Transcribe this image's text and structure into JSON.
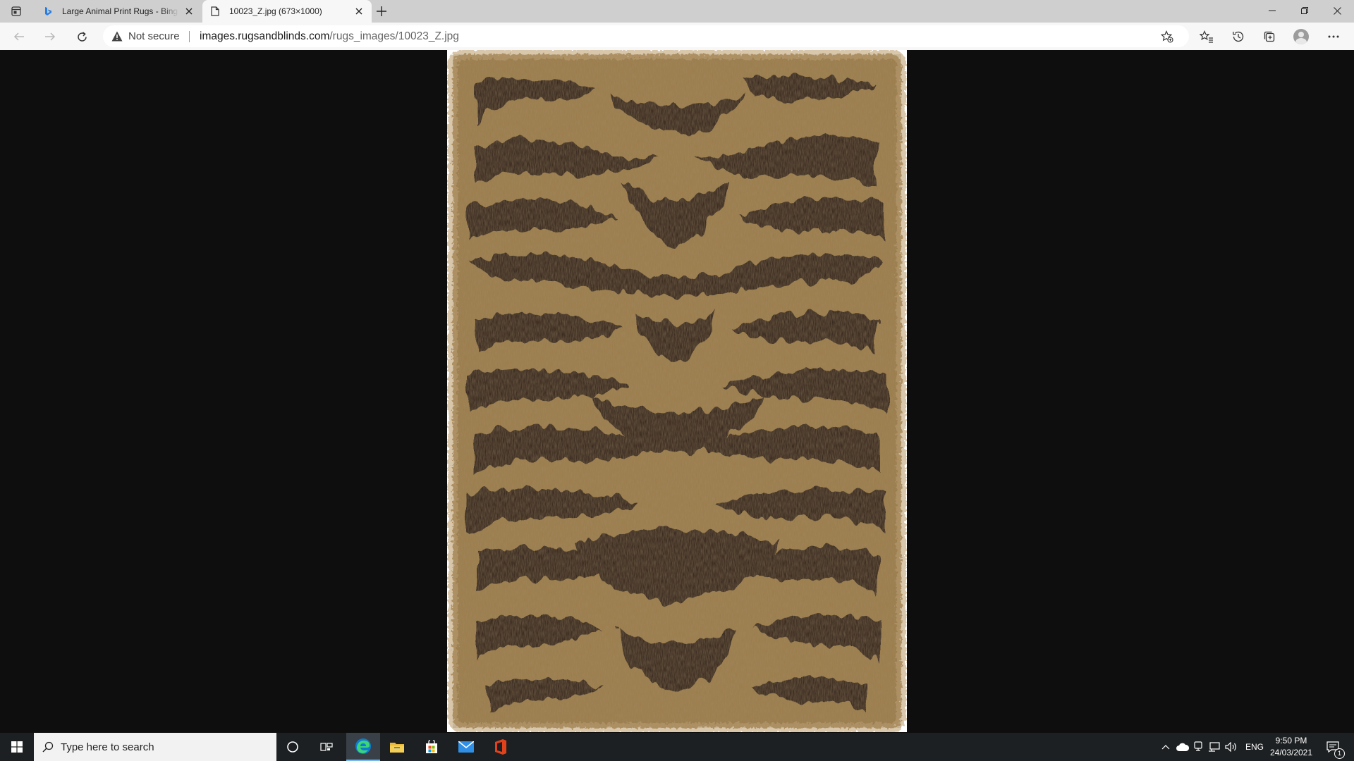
{
  "browser": {
    "tabs": [
      {
        "title": "Large Animal Print Rugs - Bing images",
        "favicon": "bing-icon",
        "active": false
      },
      {
        "title": "10023_Z.jpg (673×1000)",
        "favicon": "page-icon",
        "active": true
      }
    ],
    "security_label": "Not secure",
    "url_host": "images.rugsandblinds.com",
    "url_path": "/rugs_images/10023_Z.jpg"
  },
  "taskbar": {
    "search_placeholder": "Type here to search",
    "language": "ENG",
    "time": "9:50 PM",
    "date": "24/03/2021",
    "notification_count": "1"
  },
  "colors": {
    "rug_base": "#9c7b48",
    "rug_stripe": "#2a1f15",
    "edge_accent": "#0078d7"
  }
}
